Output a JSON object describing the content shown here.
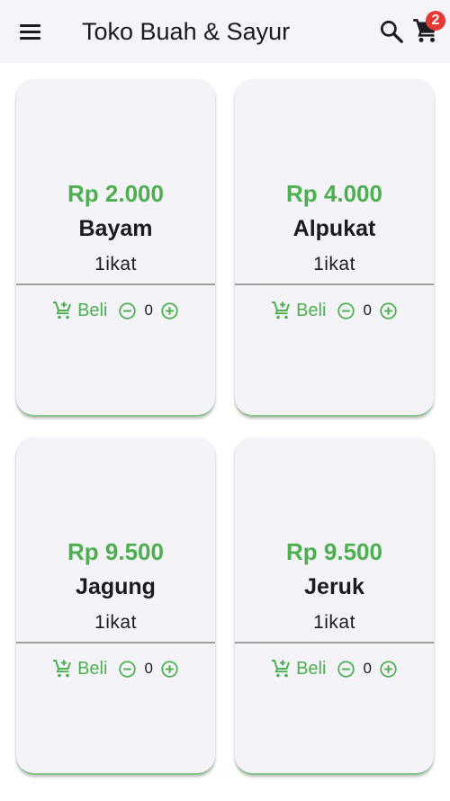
{
  "appbar": {
    "title": "Toko Buah & Sayur",
    "cart_count": "2"
  },
  "products": [
    {
      "price": "Rp 2.000",
      "name": "Bayam",
      "unit": "1ikat",
      "buy_label": "Beli",
      "qty": "0"
    },
    {
      "price": "Rp 4.000",
      "name": "Alpukat",
      "unit": "1ikat",
      "buy_label": "Beli",
      "qty": "0"
    },
    {
      "price": "Rp 9.500",
      "name": "Jagung",
      "unit": "1ikat",
      "buy_label": "Beli",
      "qty": "0"
    },
    {
      "price": "Rp 9.500",
      "name": "Jeruk",
      "unit": "1ikat",
      "buy_label": "Beli",
      "qty": "0"
    }
  ],
  "colors": {
    "accent": "#4caf50",
    "badge": "#e53935",
    "appbar": "#f5f4f9",
    "card": "#f4f3f8"
  },
  "icons": [
    "menu-icon",
    "search-icon",
    "shopping-cart-icon",
    "add-shopping-cart-icon",
    "remove-circle-icon",
    "add-circle-icon"
  ]
}
